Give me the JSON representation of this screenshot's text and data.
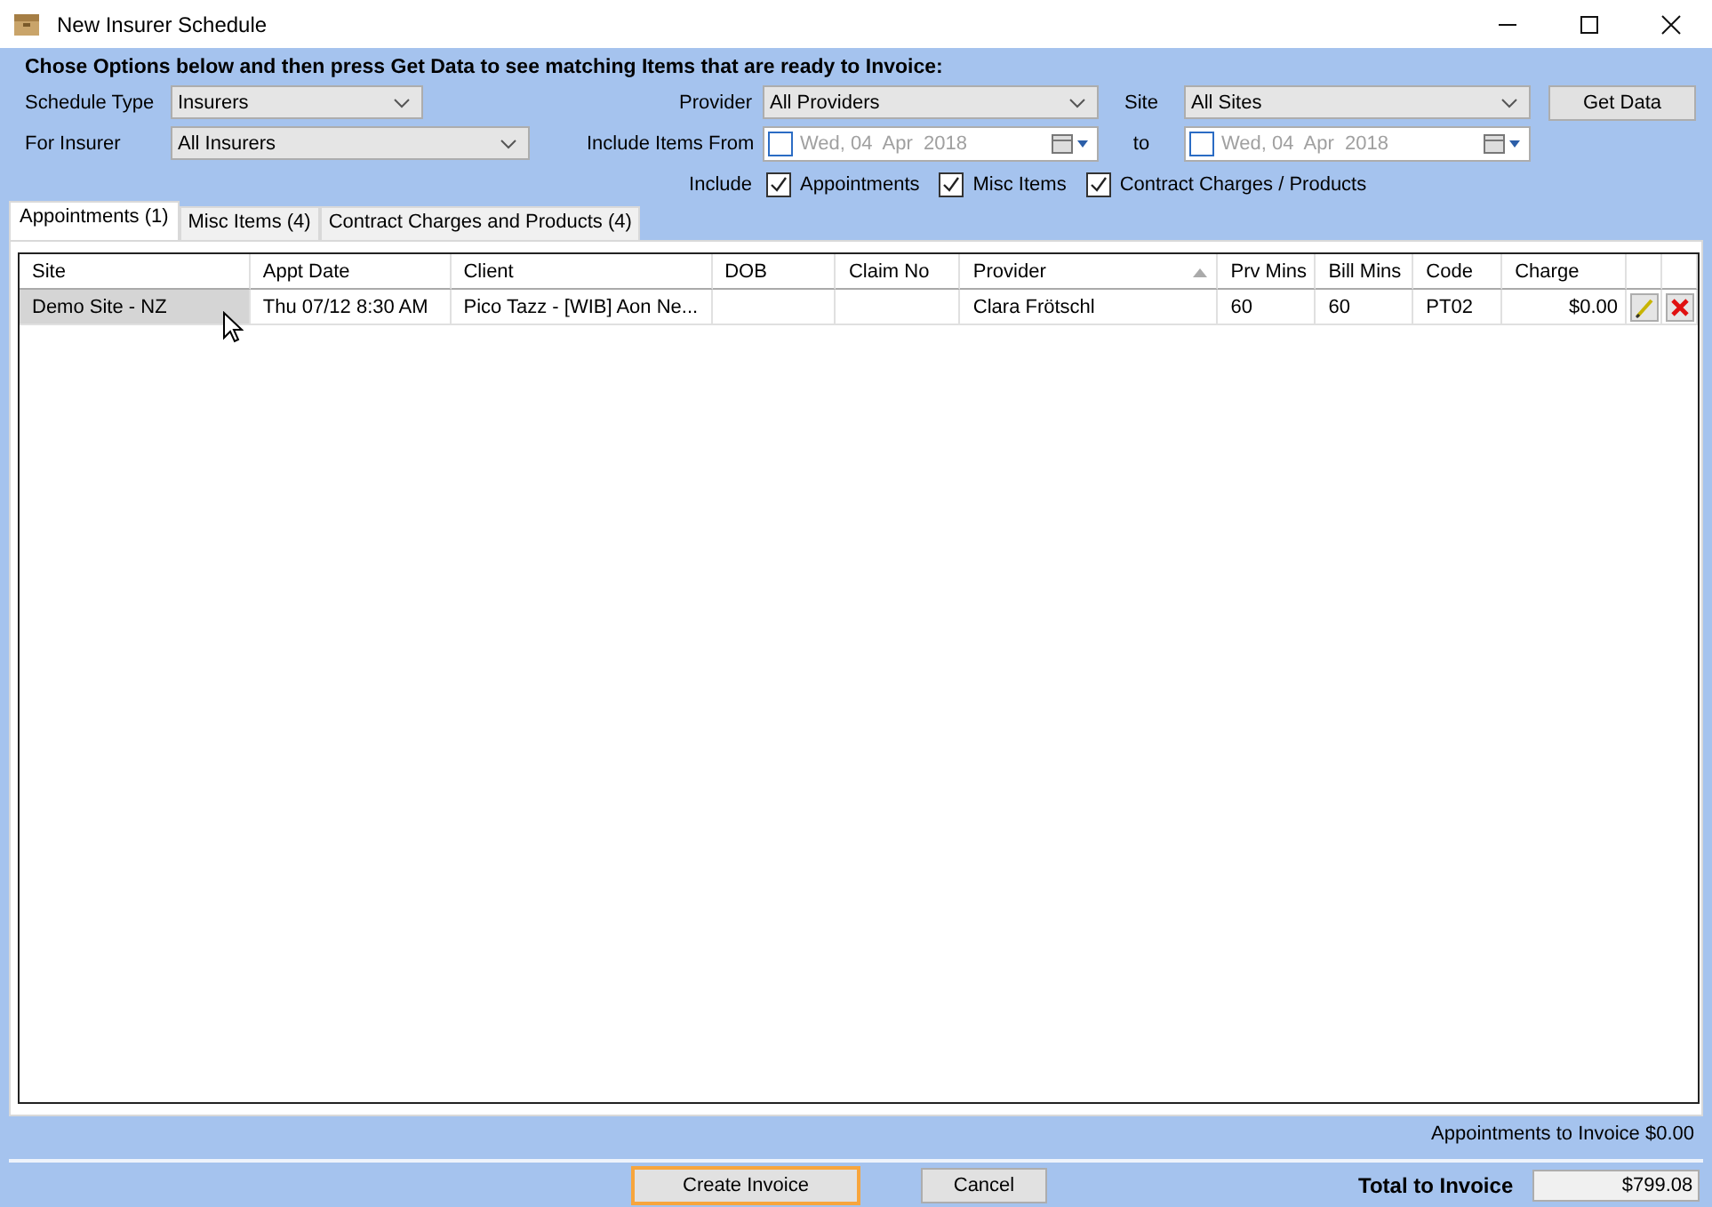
{
  "window": {
    "title": "New Insurer Schedule"
  },
  "instruction": "Chose Options below and then press Get Data to see matching Items that are ready to Invoice:",
  "filters": [
    {
      "kind": "combo",
      "label": "Schedule Type",
      "value": "Insurers"
    },
    {
      "kind": "combo",
      "label": "Provider",
      "value": "All Providers"
    },
    {
      "kind": "combo",
      "label": "Site",
      "value": "All Sites"
    },
    {
      "kind": "button",
      "label": "Get Data"
    },
    {
      "kind": "combo",
      "label": "For Insurer",
      "value": "All Insurers"
    },
    {
      "kind": "date",
      "label": "Include Items From",
      "value": "Wed, 04  Apr  2018",
      "checked": false
    },
    {
      "kind": "date",
      "label": "to",
      "value": "Wed, 04  Apr  2018",
      "checked": false
    }
  ],
  "include": {
    "label": "Include",
    "options": [
      {
        "label": "Appointments",
        "checked": true
      },
      {
        "label": "Misc Items",
        "checked": true
      },
      {
        "label": "Contract Charges / Products",
        "checked": true
      }
    ]
  },
  "tabs": [
    {
      "label": "Appointments (1)",
      "selected": true
    },
    {
      "label": "Misc Items (4)",
      "selected": false
    },
    {
      "label": "Contract Charges and Products (4)",
      "selected": false
    }
  ],
  "table": {
    "columns": [
      {
        "label": "Site",
        "sorted": false
      },
      {
        "label": "Appt Date",
        "sorted": false
      },
      {
        "label": "Client",
        "sorted": false
      },
      {
        "label": "DOB",
        "sorted": false
      },
      {
        "label": "Claim No",
        "sorted": false
      },
      {
        "label": "Provider",
        "sorted": true
      },
      {
        "label": "Prv Mins",
        "sorted": false
      },
      {
        "label": "Bill Mins",
        "sorted": false
      },
      {
        "label": "Code",
        "sorted": false
      },
      {
        "label": "Charge",
        "sorted": false
      }
    ],
    "rows": [
      {
        "cells": [
          {
            "text": "Demo Site - NZ",
            "selected": true
          },
          {
            "text": "Thu 07/12 8:30 AM",
            "selected": false
          },
          {
            "text": "Pico Tazz - [WIB] Aon Ne...",
            "selected": false
          },
          {
            "selected": false
          },
          {
            "selected": false
          },
          {
            "text": "Clara Frötschl",
            "selected": false
          },
          {
            "text": "60",
            "selected": false
          },
          {
            "text": "60",
            "selected": false
          },
          {
            "text": "PT02",
            "selected": false
          },
          {
            "text": "$0.00",
            "selected": false
          }
        ]
      }
    ]
  },
  "subtotal": "Appointments to Invoice $0.00",
  "buttons": [
    {
      "label": "Create Invoice",
      "focused": true
    },
    {
      "label": "Cancel",
      "focused": false
    }
  ],
  "total": {
    "label": "Total to Invoice",
    "value": "$799.08"
  }
}
